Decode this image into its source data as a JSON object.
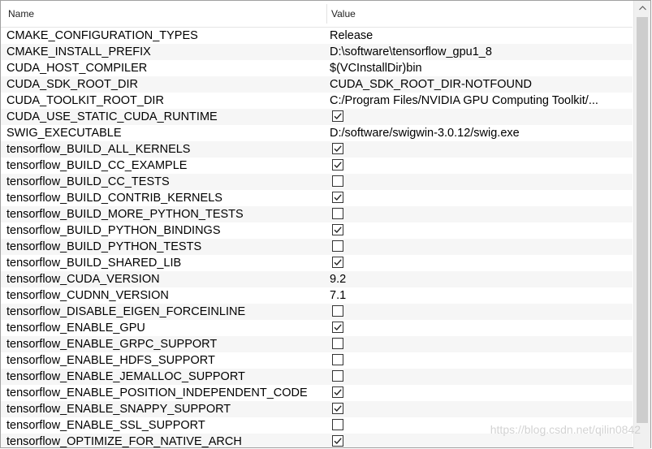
{
  "header": {
    "name_label": "Name",
    "value_label": "Value"
  },
  "rows": [
    {
      "name": "CMAKE_CONFIGURATION_TYPES",
      "type": "text",
      "value": "Release"
    },
    {
      "name": "CMAKE_INSTALL_PREFIX",
      "type": "text",
      "value": "D:\\software\\tensorflow_gpu1_8"
    },
    {
      "name": "CUDA_HOST_COMPILER",
      "type": "text",
      "value": "$(VCInstallDir)bin"
    },
    {
      "name": "CUDA_SDK_ROOT_DIR",
      "type": "text",
      "value": "CUDA_SDK_ROOT_DIR-NOTFOUND"
    },
    {
      "name": "CUDA_TOOLKIT_ROOT_DIR",
      "type": "text",
      "value": "C:/Program Files/NVIDIA GPU Computing Toolkit/..."
    },
    {
      "name": "CUDA_USE_STATIC_CUDA_RUNTIME",
      "type": "bool",
      "checked": true
    },
    {
      "name": "SWIG_EXECUTABLE",
      "type": "text",
      "value": "D:/software/swigwin-3.0.12/swig.exe"
    },
    {
      "name": "tensorflow_BUILD_ALL_KERNELS",
      "type": "bool",
      "checked": true
    },
    {
      "name": "tensorflow_BUILD_CC_EXAMPLE",
      "type": "bool",
      "checked": true
    },
    {
      "name": "tensorflow_BUILD_CC_TESTS",
      "type": "bool",
      "checked": false
    },
    {
      "name": "tensorflow_BUILD_CONTRIB_KERNELS",
      "type": "bool",
      "checked": true
    },
    {
      "name": "tensorflow_BUILD_MORE_PYTHON_TESTS",
      "type": "bool",
      "checked": false
    },
    {
      "name": "tensorflow_BUILD_PYTHON_BINDINGS",
      "type": "bool",
      "checked": true
    },
    {
      "name": "tensorflow_BUILD_PYTHON_TESTS",
      "type": "bool",
      "checked": false
    },
    {
      "name": "tensorflow_BUILD_SHARED_LIB",
      "type": "bool",
      "checked": true
    },
    {
      "name": "tensorflow_CUDA_VERSION",
      "type": "text",
      "value": "9.2"
    },
    {
      "name": "tensorflow_CUDNN_VERSION",
      "type": "text",
      "value": "7.1"
    },
    {
      "name": "tensorflow_DISABLE_EIGEN_FORCEINLINE",
      "type": "bool",
      "checked": false
    },
    {
      "name": "tensorflow_ENABLE_GPU",
      "type": "bool",
      "checked": true
    },
    {
      "name": "tensorflow_ENABLE_GRPC_SUPPORT",
      "type": "bool",
      "checked": false
    },
    {
      "name": "tensorflow_ENABLE_HDFS_SUPPORT",
      "type": "bool",
      "checked": false
    },
    {
      "name": "tensorflow_ENABLE_JEMALLOC_SUPPORT",
      "type": "bool",
      "checked": false
    },
    {
      "name": "tensorflow_ENABLE_POSITION_INDEPENDENT_CODE",
      "type": "bool",
      "checked": true
    },
    {
      "name": "tensorflow_ENABLE_SNAPPY_SUPPORT",
      "type": "bool",
      "checked": true
    },
    {
      "name": "tensorflow_ENABLE_SSL_SUPPORT",
      "type": "bool",
      "checked": false
    },
    {
      "name": "tensorflow_OPTIMIZE_FOR_NATIVE_ARCH",
      "type": "bool",
      "checked": true
    }
  ],
  "watermark": "https://blog.csdn.net/qilin0842",
  "icons": {
    "scroll_up": "chevron-up-icon",
    "checkbox": "check-icon"
  }
}
